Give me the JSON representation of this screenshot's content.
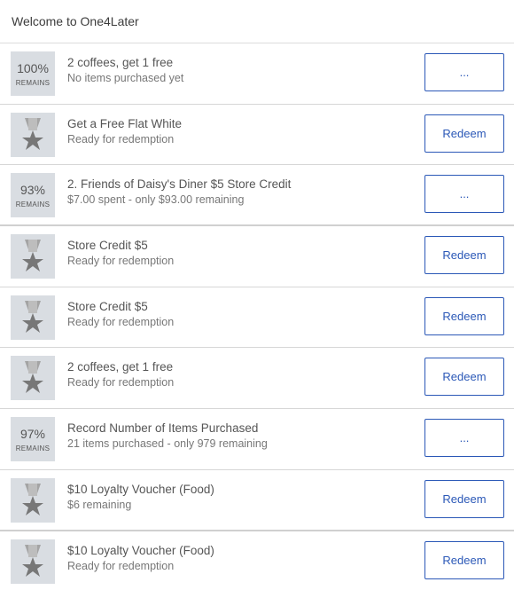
{
  "header": {
    "title": "Welcome to One4Later"
  },
  "rewards": [
    {
      "kind": "progress",
      "percent": "100%",
      "remains_label": "REMAINS",
      "title": "2 coffees, get 1 free",
      "subtitle": "No items purchased yet",
      "action_label": "..."
    },
    {
      "kind": "medal",
      "icon": "medal-icon",
      "title": "Get a Free Flat White",
      "subtitle": "Ready for redemption",
      "action_label": "Redeem"
    },
    {
      "kind": "progress",
      "percent": "93%",
      "remains_label": "REMAINS",
      "title": "2. Friends of Daisy's Diner $5 Store Credit",
      "subtitle": "$7.00 spent - only $93.00 remaining",
      "action_label": "..."
    },
    {
      "kind": "medal",
      "icon": "medal-icon",
      "title": "Store Credit $5",
      "subtitle": "Ready for redemption",
      "action_label": "Redeem"
    },
    {
      "kind": "medal",
      "icon": "medal-icon",
      "title": "Store Credit $5",
      "subtitle": "Ready for redemption",
      "action_label": "Redeem"
    },
    {
      "kind": "medal",
      "icon": "medal-icon",
      "title": "2 coffees, get 1 free",
      "subtitle": "Ready for redemption",
      "action_label": "Redeem"
    },
    {
      "kind": "progress",
      "percent": "97%",
      "remains_label": "REMAINS",
      "title": "Record Number of Items Purchased",
      "subtitle": "21 items purchased - only 979 remaining",
      "action_label": "..."
    },
    {
      "kind": "medal",
      "icon": "medal-icon",
      "title": "$10 Loyalty Voucher (Food)",
      "subtitle": "$6 remaining",
      "action_label": "Redeem"
    },
    {
      "kind": "medal",
      "icon": "medal-icon",
      "title": "$10 Loyalty Voucher (Food)",
      "subtitle": "Ready for redemption",
      "action_label": "Redeem"
    }
  ],
  "colors": {
    "accent": "#2b58b7",
    "badge_bg": "#d9dde2",
    "medal": "#8a8a8a"
  }
}
